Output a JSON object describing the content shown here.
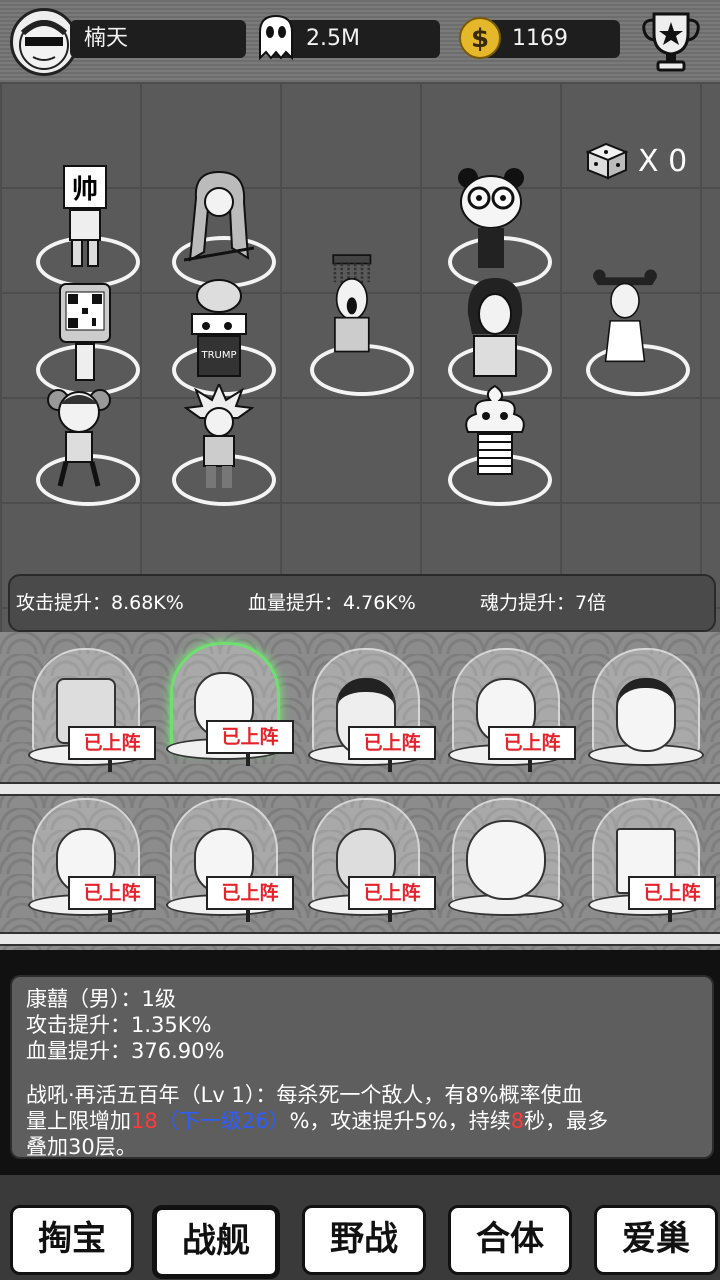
{
  "header": {
    "player_name": "楠天",
    "souls": "2.5M",
    "coins": "1169"
  },
  "board": {
    "dice_count": "X 0"
  },
  "stats_bar": {
    "attack": "攻击提升：8.68K%",
    "hp": "血量提升：4.76K%",
    "soul": "魂力提升：7倍"
  },
  "roster": {
    "deployed_label": "已上阵"
  },
  "detail": {
    "name_line": "康囍（男）：1级",
    "attack_line": "攻击提升：1.35K%",
    "hp_line": "血量提升：376.90%",
    "skill_intro": "战吼·再活五百年（Lv 1）：每杀死一个敌人，有8%概率使血",
    "skill_part2_a": "量上限增加",
    "skill_value": "18",
    "skill_next": "（下一级26）",
    "skill_part2_b": "%，攻速提升5%，持续",
    "skill_duration": "8",
    "skill_part2_c": "秒，最多",
    "skill_part3": "叠加30层。"
  },
  "nav": {
    "treasure": "掏宝",
    "warship": "战舰",
    "field": "野战",
    "merge": "合体",
    "nest": "爱巢"
  }
}
